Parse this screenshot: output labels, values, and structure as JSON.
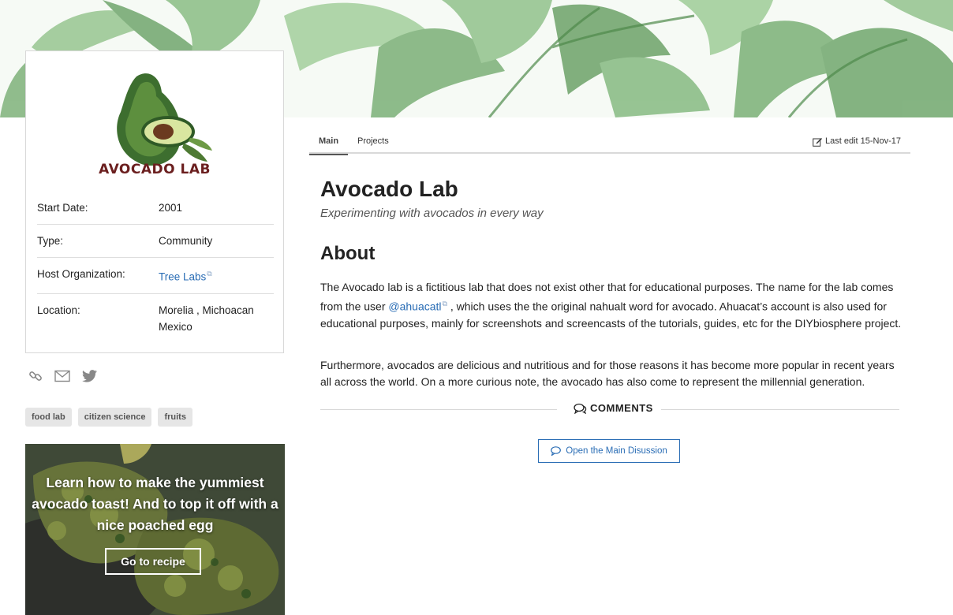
{
  "profile": {
    "logo_text": "AVOCADO LAB",
    "rows": [
      {
        "label": "Start Date:",
        "value": "2001"
      },
      {
        "label": "Type:",
        "value": "Community"
      },
      {
        "label": "Host Organization:",
        "value": "Tree Labs"
      },
      {
        "label": "Location:",
        "value": "Morelia , Michoacan Mexico"
      }
    ]
  },
  "social": [
    "link-icon",
    "mail-icon",
    "twitter-icon"
  ],
  "tags": [
    "food lab",
    "citizen science",
    "fruits"
  ],
  "promo": {
    "text": "Learn how to make the yummiest avocado toast! And to top it off with a nice poached egg",
    "button": "Go to recipe"
  },
  "tabs": [
    "Main",
    "Projects"
  ],
  "last_edit": "Last edit 15-Nov-17",
  "title": "Avocado Lab",
  "subtitle": "Experimenting with avocados in every way",
  "about_heading": "About",
  "about": {
    "p1_before": "The Avocado lab is a fictitious lab that does not exist other that for educational purposes. The name for the lab comes from the user ",
    "p1_link": "@ahuacatl",
    "p1_after": " , which uses the the original nahualt word for avocado. Ahuacat’s account is also used for educational purposes, mainly for screenshots and screencasts of the tutorials, guides, etc for the DIYbiosphere project.",
    "p2": "Furthermore, avocados are delicious and nutritious and for those reasons it has become more popular in recent years all across the world. On a more curious note, the avocado has also come to represent the millennial generation."
  },
  "comments_label": "COMMENTS",
  "discussion_button": "Open the Main Disussion",
  "colors": {
    "link": "#2a6db5",
    "logo_text": "#6b1f1f"
  }
}
